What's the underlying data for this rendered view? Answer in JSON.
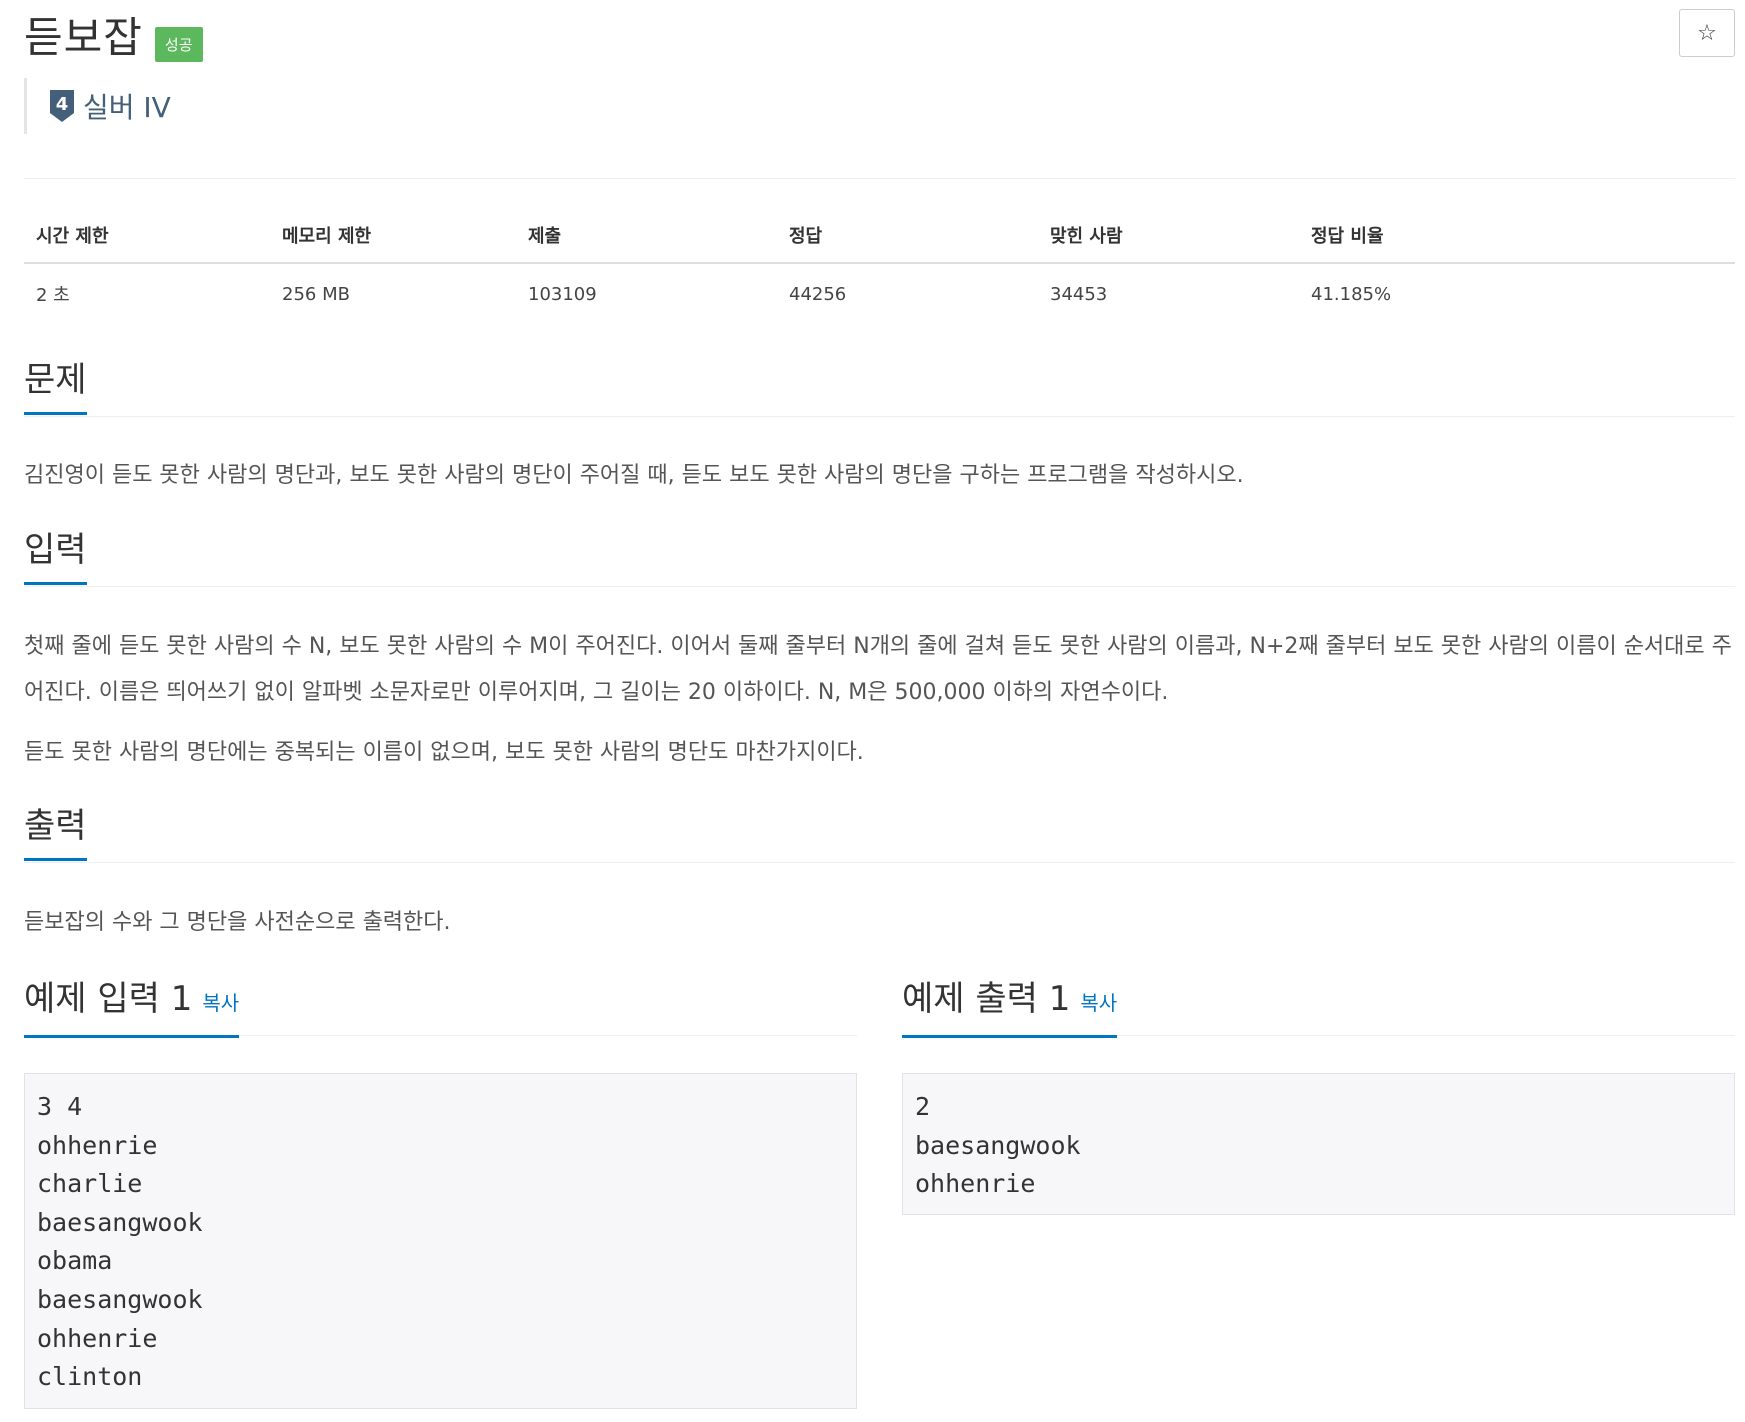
{
  "problem": {
    "title": "듣보잡",
    "status_badge": "성공"
  },
  "tier": {
    "level_number": "4",
    "label": "실버 IV"
  },
  "favorite_icon": "star-icon",
  "info_table": {
    "headers": [
      "시간 제한",
      "메모리 제한",
      "제출",
      "정답",
      "맞힌 사람",
      "정답 비율"
    ],
    "values": [
      "2 초",
      "256 MB",
      "103109",
      "44256",
      "34453",
      "41.185%"
    ]
  },
  "sections": {
    "problem": {
      "heading": "문제",
      "text": "김진영이 듣도 못한 사람의 명단과, 보도 못한 사람의 명단이 주어질 때, 듣도 보도 못한 사람의 명단을 구하는 프로그램을 작성하시오."
    },
    "input": {
      "heading": "입력",
      "text1": "첫째 줄에 듣도 못한 사람의 수 N, 보도 못한 사람의 수 M이 주어진다. 이어서 둘째 줄부터 N개의 줄에 걸쳐 듣도 못한 사람의 이름과, N+2째 줄부터 보도 못한 사람의 이름이 순서대로 주어진다. 이름은 띄어쓰기 없이 알파벳 소문자로만 이루어지며, 그 길이는 20 이하이다. N, M은 500,000 이하의 자연수이다.",
      "text2": "듣도 못한 사람의 명단에는 중복되는 이름이 없으며, 보도 못한 사람의 명단도 마찬가지이다."
    },
    "output": {
      "heading": "출력",
      "text": "듣보잡의 수와 그 명단을 사전순으로 출력한다."
    }
  },
  "samples": {
    "input": {
      "heading": "예제 입력 1",
      "copy_label": "복사",
      "content": "3 4\nohhenrie\ncharlie\nbaesangwook\nobama\nbaesangwook\nohhenrie\nclinton"
    },
    "output": {
      "heading": "예제 출력 1",
      "copy_label": "복사",
      "content": "2\nbaesangwook\nohhenrie"
    }
  },
  "colors": {
    "accent": "#0076c0",
    "success": "#5cb85c",
    "tier_silver": "#435f7a"
  }
}
